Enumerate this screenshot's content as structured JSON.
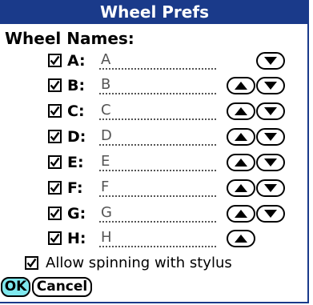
{
  "window": {
    "title": "Wheel Prefs"
  },
  "section": {
    "label": "Wheel Names:"
  },
  "wheels": [
    {
      "letter": "A:",
      "value": "A",
      "checked": true,
      "up": false,
      "down": true
    },
    {
      "letter": "B:",
      "value": "B",
      "checked": true,
      "up": true,
      "down": true
    },
    {
      "letter": "C:",
      "value": "C",
      "checked": true,
      "up": true,
      "down": true
    },
    {
      "letter": "D:",
      "value": "D",
      "checked": true,
      "up": true,
      "down": true
    },
    {
      "letter": "E:",
      "value": "E",
      "checked": true,
      "up": true,
      "down": true
    },
    {
      "letter": "F:",
      "value": "F",
      "checked": true,
      "up": true,
      "down": true
    },
    {
      "letter": "G:",
      "value": "G",
      "checked": true,
      "up": true,
      "down": true
    },
    {
      "letter": "H:",
      "value": "H",
      "checked": true,
      "up": true,
      "down": false
    }
  ],
  "options": {
    "allow_spinning_label": "Allow spinning with stylus",
    "allow_spinning_checked": true
  },
  "buttons": {
    "ok_label": "OK",
    "cancel_label": "Cancel"
  },
  "icons": {
    "check": "checkmark-icon",
    "up": "up-arrow-icon",
    "down": "down-arrow-icon"
  },
  "colors": {
    "titlebar": "#1a3a8a",
    "ok_button": "#7fe8ee"
  }
}
